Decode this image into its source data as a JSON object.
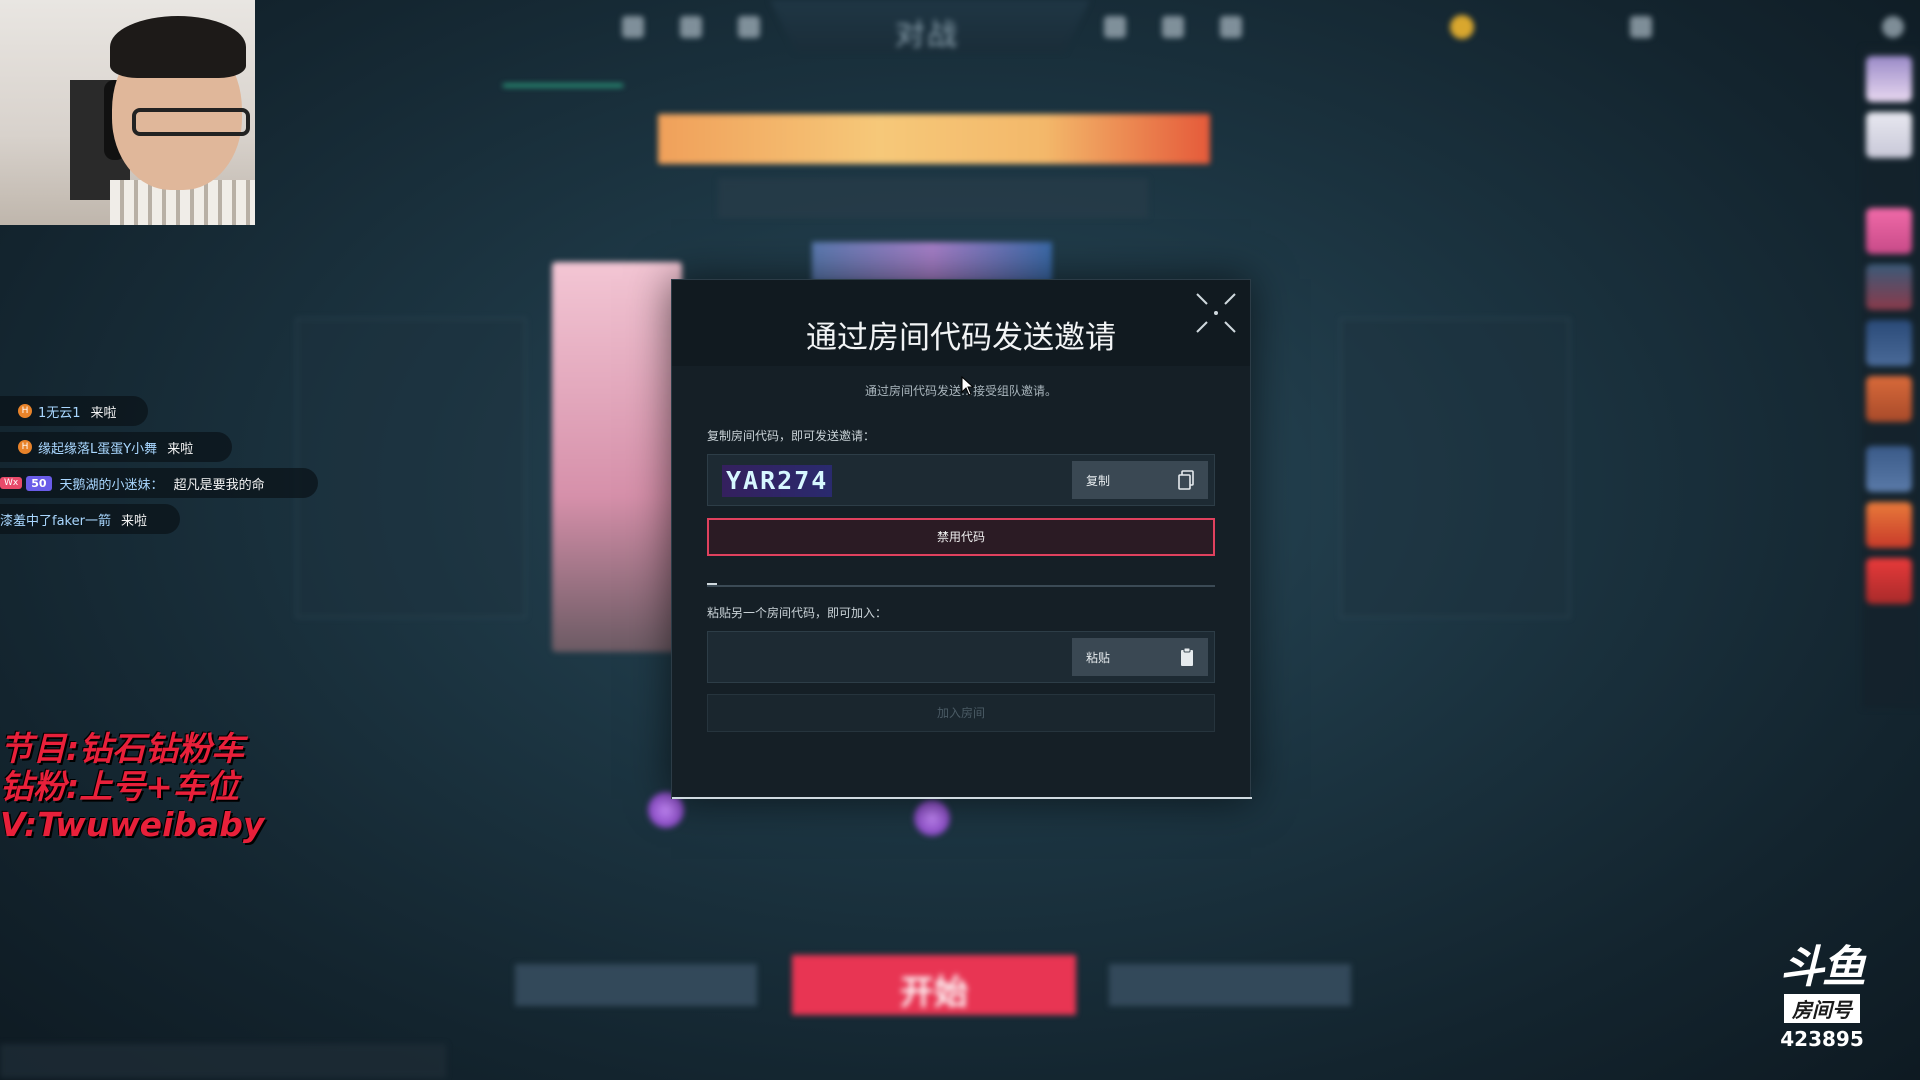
{
  "modal": {
    "title": "通过房间代码发送邀请",
    "description": "通过房间代码发送…接受组队邀请。",
    "copy_label": "复制房间代码，即可发送邀请：",
    "room_code": "YAR274",
    "copy_button": "复制",
    "disable_button": "禁用代码",
    "paste_label": "粘贴另一个房间代码，即可加入：",
    "paste_placeholder": "",
    "paste_button": "粘贴",
    "join_button": "加入房间"
  },
  "game": {
    "nav_title": "对战",
    "start_button": "开始"
  },
  "chat": [
    {
      "name": "1无云1",
      "message": "来啦",
      "badge": "H"
    },
    {
      "name": "缘起缘落L蛋蛋Y小舞",
      "message": "来啦",
      "badge": "H"
    },
    {
      "tag_wx": "Wx",
      "level": "50",
      "name": "天鹅湖的小迷妹：",
      "message": "超凡是要我的命"
    },
    {
      "name": "漆羞中了faker一箭",
      "message": "来啦"
    }
  ],
  "promo": {
    "line1": "节目:钻石钻粉车",
    "line2": "钻粉:上号+车位",
    "line3": "V:Twuweibaby"
  },
  "watermark": {
    "logo": "斗鱼",
    "room_label": "房间号",
    "room_number": "423895"
  },
  "colors": {
    "accent_teal": "#2fb48c",
    "danger_red": "#e0415e",
    "start_red": "#e83553"
  }
}
